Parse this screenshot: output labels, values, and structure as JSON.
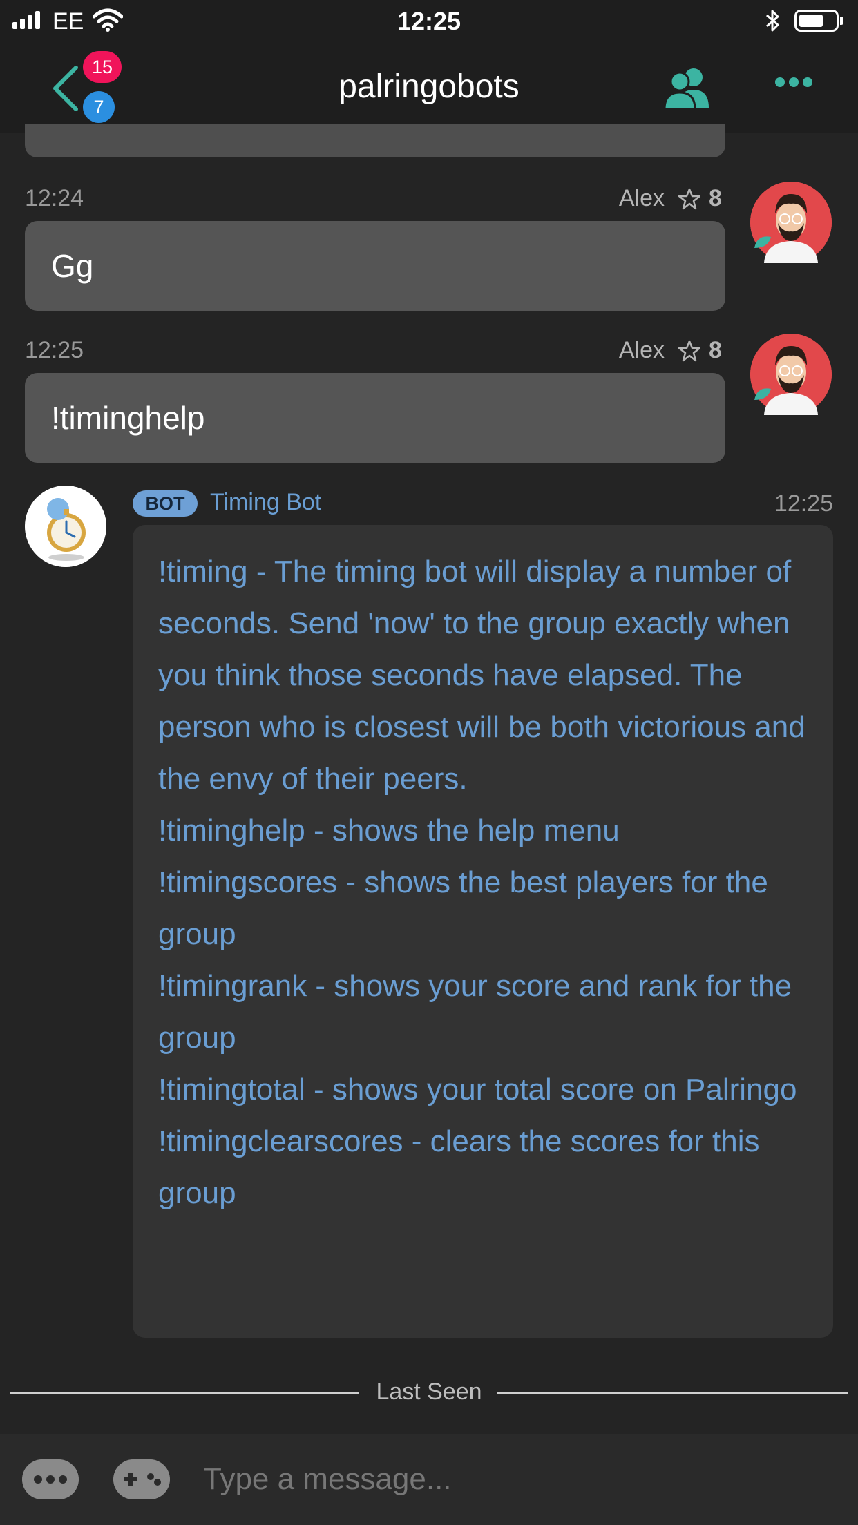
{
  "status_bar": {
    "carrier": "EE",
    "time": "12:25"
  },
  "nav": {
    "title": "palringobots",
    "badge_unread": "15",
    "badge_secondary": "7"
  },
  "messages": [
    {
      "time": "12:24",
      "author": "Alex",
      "score": "8",
      "text": "Gg"
    },
    {
      "time": "12:25",
      "author": "Alex",
      "score": "8",
      "text": "!timinghelp"
    }
  ],
  "bot_message": {
    "tag": "BOT",
    "name": "Timing Bot",
    "time": "12:25",
    "lines": [
      "!timing - The timing bot will display a number of seconds. Send 'now' to the group exactly when you think those seconds have elapsed. The person who is closest will be both victorious and the envy of their peers.",
      "!timinghelp - shows the help menu",
      "!timingscores - shows the best players for the group",
      "!timingrank - shows your score and rank for the group",
      "!timingtotal - shows your total score on Palringo",
      "!timingclearscores - clears the scores for this group"
    ]
  },
  "divider": {
    "label": "Last Seen"
  },
  "composer": {
    "placeholder": "Type a message..."
  },
  "colors": {
    "accent": "#3cb4a2",
    "badge_red": "#f0145a",
    "badge_blue": "#2b8fe0",
    "bot_text": "#6a9ed3",
    "background": "#242424"
  }
}
